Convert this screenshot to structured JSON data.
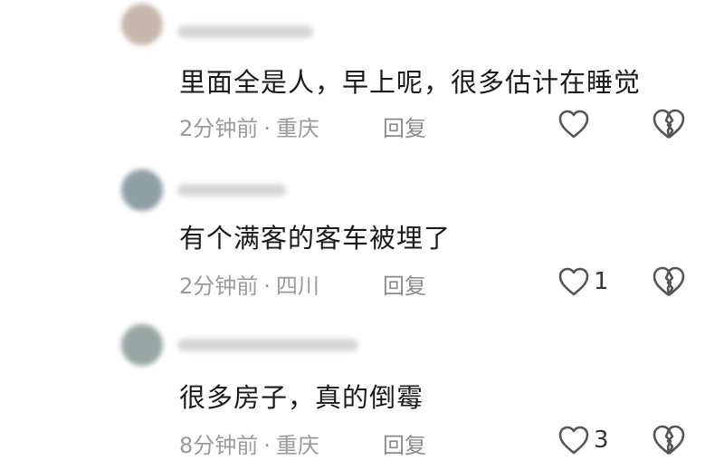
{
  "comments": [
    {
      "text": "里面全是人，早上呢，很多估计在睡觉",
      "time": "2分钟前",
      "separator": "·",
      "location": "重庆",
      "reply_label": "回复",
      "like_count": "",
      "avatar_color": "#c7b7ad"
    },
    {
      "text": "有个满客的客车被埋了",
      "time": "2分钟前",
      "separator": "·",
      "location": "四川",
      "reply_label": "回复",
      "like_count": "1",
      "avatar_color": "#8f9fa6"
    },
    {
      "text": "很多房子，真的倒霉",
      "time": "8分钟前",
      "separator": "·",
      "location": "重庆",
      "reply_label": "回复",
      "like_count": "3",
      "avatar_color": "#98a7a4"
    }
  ],
  "colors": {
    "content_text": "#1a1a1a",
    "meta_text": "#9a9a9a",
    "icon_stroke": "#555555"
  },
  "icons": {
    "like": "heart-outline-icon",
    "dislike": "broken-heart-icon"
  }
}
